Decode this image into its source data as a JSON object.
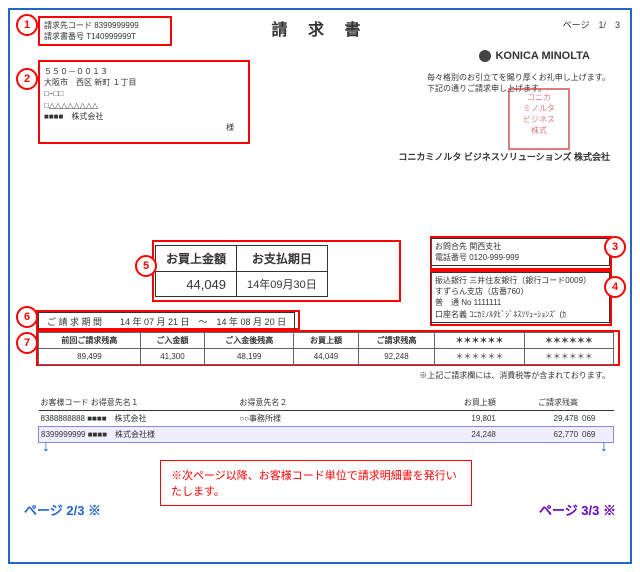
{
  "title": "請 求 書",
  "page": "ページ　1/　3",
  "box1": {
    "l1": "請求先コード 8399999999",
    "l2": "請求書番号 T140999999T"
  },
  "box2": {
    "zip": "５５０－００１３",
    "addr": "大阪市　西区  新町  １丁目",
    "l3": "□−□□",
    "l4": "□△△△△△△△△",
    "l5": "■■■■　株式会社",
    "sama": "様"
  },
  "km": "KONICA MINOLTA",
  "greet1": "毎々格別のお引立てを賜り厚くお礼申し上げます。",
  "greet2": "下記の通りご請求申し上げます。",
  "company": "コニカミノルタ ビジネスソリューションズ 株式会社",
  "main": {
    "h1": "お買上金額",
    "h2": "お支払期日",
    "v1": "44,049",
    "v2": "14年09月30日"
  },
  "contact": {
    "l1": "お問合先 関西支社",
    "l2": "電話番号 0120-999-999"
  },
  "bank": {
    "l1": "振込銀行 三井住友銀行（銀行コード0009）",
    "l2": "すずらん支店（店番760）",
    "l3": "普　通  No  1111111",
    "l4": "口座名義 ｺﾆｶﾐﾉﾙﾀﾋﾞｼﾞﾈｽｿﾘｭｰｼｮﾝｽﾞ (ｶ"
  },
  "period": "ご 請 求 期 間　　14 年 07 月 21 日　～　14 年 08 月 20 日",
  "sumH": [
    "前回ご請求残高",
    "ご入金額",
    "ご入金後残高",
    "お買上額",
    "ご請求残高",
    "＊＊＊＊＊＊",
    "＊＊＊＊＊＊"
  ],
  "sumV": [
    "89,499",
    "41,300",
    "48,199",
    "44,049",
    "92,248",
    "＊＊＊＊＊＊",
    "＊＊＊＊＊＊"
  ],
  "note": "※上記ご請求欄には、消費税等が含まれております。",
  "custH": [
    "お客様コード お得意先名１",
    "お得意先名２",
    "お買上額",
    "ご請求残高"
  ],
  "cust": [
    {
      "c1": "8388888888  ■■■■　株式会社",
      "c2": "○○事務所様",
      "c3": "19,801",
      "c4": "29,478",
      "c5": "069"
    },
    {
      "c1": "8399999999  ■■■■　株式会社様",
      "c2": "",
      "c3": "24,248",
      "c4": "62,770",
      "c5": "069"
    }
  ],
  "rednote": "※次ページ以降、お客様コード単位で請求明細書を発行いたします。",
  "pg23": "ページ 2/3 ※",
  "pg33": "ページ 3/3 ※"
}
